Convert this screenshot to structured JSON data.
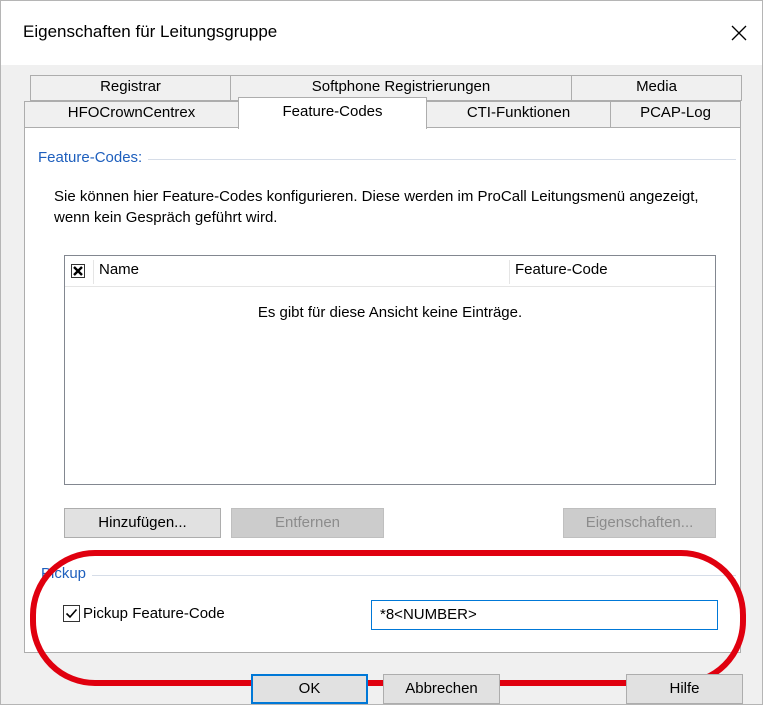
{
  "window": {
    "title": "Eigenschaften für Leitungsgruppe",
    "close_glyph": "✕"
  },
  "tabs": {
    "row1": [
      {
        "label": "Registrar"
      },
      {
        "label": "Softphone Registrierungen"
      },
      {
        "label": "Media"
      }
    ],
    "row2": [
      {
        "label": "HFOCrownCentrex"
      },
      {
        "label": "Feature-Codes"
      },
      {
        "label": "CTI-Funktionen"
      },
      {
        "label": "PCAP-Log"
      }
    ],
    "active": "Feature-Codes"
  },
  "feature_codes": {
    "group_label": "Feature-Codes:",
    "description": "Sie können hier Feature-Codes konfigurieren. Diese werden im ProCall Leitungsmenü angezeigt, wenn kein Gespräch geführt wird.",
    "list": {
      "columns": [
        "Name",
        "Feature-Code"
      ],
      "empty_text": "Es gibt für diese Ansicht keine Einträge.",
      "header_check_glyph": "✖"
    },
    "buttons": {
      "add": "Hinzufügen...",
      "remove": "Entfernen",
      "properties": "Eigenschaften..."
    }
  },
  "pickup": {
    "group_label": "Pickup",
    "checkbox_label": "Pickup Feature-Code",
    "checked": true,
    "value": "*8<NUMBER>"
  },
  "footer": {
    "ok": "OK",
    "cancel": "Abbrechen",
    "help": "Hilfe"
  },
  "colors": {
    "highlight_ellipse": "#e0000f",
    "group_label": "#1e5fbd",
    "focus_border": "#0078d7"
  }
}
